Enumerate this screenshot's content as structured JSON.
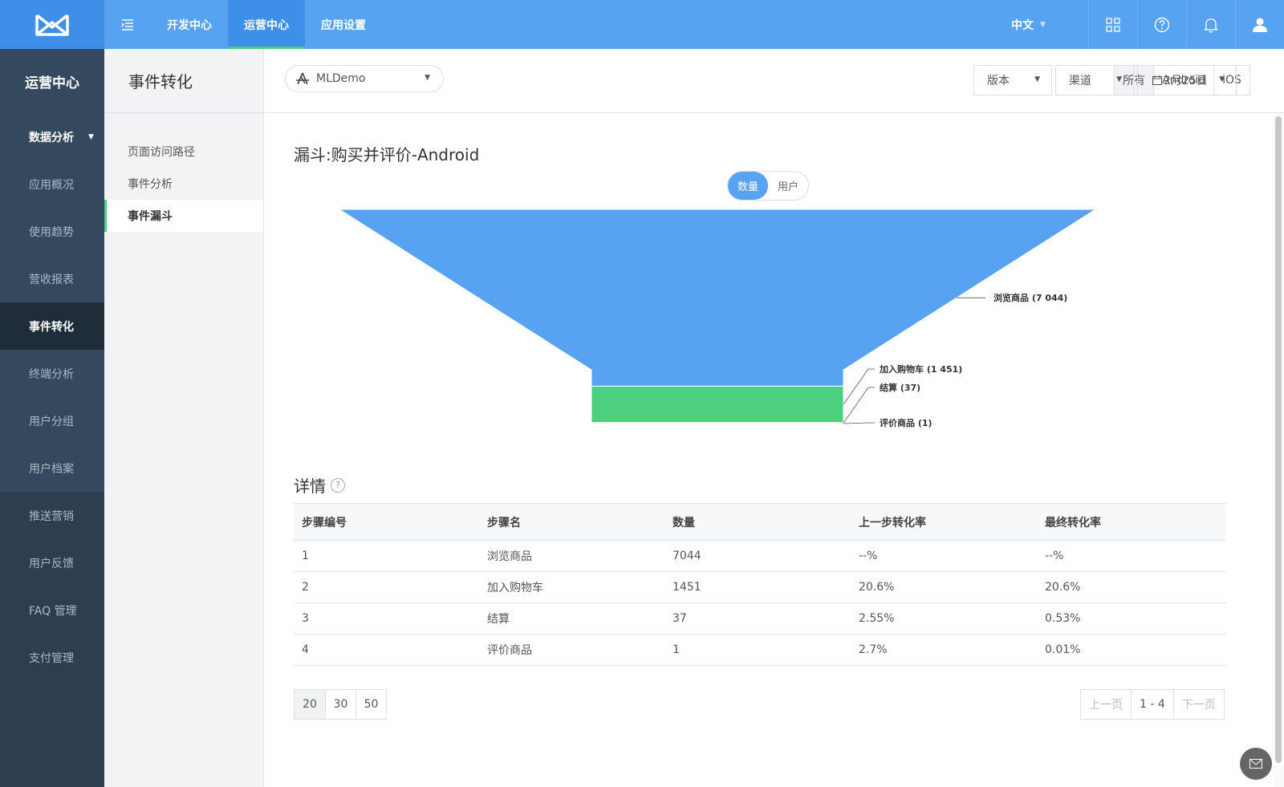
{
  "topbar": {
    "nav": [
      "开发中心",
      "运营中心",
      "应用设置"
    ],
    "active_nav": "运营中心",
    "language": "中文",
    "icons": [
      "apps-grid-icon",
      "help-icon",
      "bell-icon",
      "user-icon"
    ]
  },
  "sidebar": {
    "title": "运营中心",
    "section": "数据分析",
    "items": [
      "应用概况",
      "使用趋势",
      "营收报表",
      "事件转化",
      "终端分析",
      "用户分组",
      "用户档案"
    ],
    "active": "事件转化",
    "bottom_items": [
      "推送营销",
      "用户反馈",
      "FAQ 管理",
      "支付管理"
    ]
  },
  "subnav": {
    "title": "事件转化",
    "items": [
      "页面访问路径",
      "事件分析",
      "事件漏斗"
    ],
    "active": "事件漏斗"
  },
  "filters": {
    "app": "MLDemo",
    "platforms": [
      "所有",
      "Android",
      "iOS"
    ],
    "selected_platform": "所有",
    "version": "版本",
    "channel": "渠道",
    "date": "2月25日"
  },
  "chart": {
    "title": "漏斗:购买并评价-Android",
    "toggle": [
      "数量",
      "用户"
    ],
    "toggle_selected": "数量"
  },
  "chart_data": {
    "type": "funnel",
    "categories": [
      "浏览商品",
      "加入购物车",
      "结算",
      "评价商品"
    ],
    "values": [
      7044,
      1451,
      37,
      1
    ],
    "labels": [
      "浏览商品 (7 044)",
      "加入购物车 (1 451)",
      "结算 (37)",
      "评价商品 (1)"
    ],
    "colors": [
      "#57a3f1",
      "#4ccf7f",
      "#f7b84f",
      "#ee6b6b"
    ]
  },
  "details": {
    "title": "详情",
    "columns": [
      "步骤编号",
      "步骤名",
      "数量",
      "上一步转化率",
      "最终转化率"
    ],
    "rows": [
      [
        "1",
        "浏览商品",
        "7044",
        "--%",
        "--%"
      ],
      [
        "2",
        "加入购物车",
        "1451",
        "20.6%",
        "20.6%"
      ],
      [
        "3",
        "结算",
        "37",
        "2.55%",
        "0.53%"
      ],
      [
        "4",
        "评价商品",
        "1",
        "2.7%",
        "0.01%"
      ]
    ]
  },
  "pagination": {
    "page_sizes": [
      "20",
      "30",
      "50"
    ],
    "prev": "上一页",
    "range": "1 - 4",
    "next": "下一页"
  }
}
